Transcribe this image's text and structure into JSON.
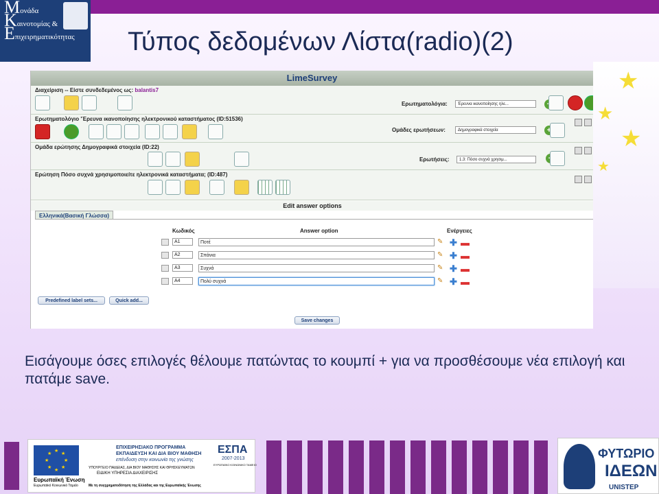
{
  "slide": {
    "title": "Τύπος δεδομένων Λίστα(radio)(2)",
    "description": "Εισάγουμε όσες επιλογές θέλουμε πατώντας το κουμπί + για να προσθέσουμε νέα επιλογή και πατάμε save."
  },
  "logo": {
    "line1_initial": "Μ",
    "line1_rest": "ονάδα",
    "line2_initial": "Κ",
    "line2_rest": "αινοτομίας &",
    "line3_initial": "Ε",
    "line3_rest": "πιχειρηματικότητας"
  },
  "app": {
    "name": "LimeSurvey",
    "admin_label": "Διαχείριση -- Είστε συνδεδεμένος ως:",
    "admin_user": "balantis7",
    "surveys_label": "Ερωτηματολόγια:",
    "surveys_value": "Έρευνα ικανοποίησης ηλε...",
    "survey_bar": "Ερωτηματολόγιο 'Έρευνα ικανοποίησης ηλεκτρονικού καταστήματος (ID:51536)",
    "groups_label": "Ομάδες ερωτήσεων:",
    "groups_value": "Δημογραφικά στοιχεία",
    "group_bar": "Ομάδα ερώτησης Δημογραφικά στοιχεία (ID:22)",
    "questions_label": "Ερωτήσεις:",
    "questions_value": "1.3: Πόσο συχνά χρησιμ...",
    "question_bar_label": "Ερώτηση",
    "question_bar_text": "Πόσο συχνά χρησιμοποιείτε ηλεκτρονικά καταστήματα; (ID:487)",
    "edit_title": "Edit answer options",
    "tab_label": "Ελληνικά(Βασική Γλώσσα)",
    "col_code": "Κωδικός",
    "col_option": "Answer option",
    "col_actions": "Ενέργειες",
    "answers": [
      {
        "code": "A1",
        "text": "Ποτέ"
      },
      {
        "code": "A2",
        "text": "Σπάνια"
      },
      {
        "code": "A3",
        "text": "Συχνά"
      },
      {
        "code": "A4",
        "text": "Πολύ συχνά"
      }
    ],
    "predefined_button": "Predefined label sets...",
    "quick_add_button": "Quick add...",
    "save_button": "Save changes"
  },
  "footer": {
    "eu_label": "Ευρωπαϊκή Ένωση",
    "eu_sub": "Ευρωπαϊκό Κοινωνικό Ταμείο",
    "program_line1": "ΕΠΙΧΕΙΡΗΣΙΑΚΟ ΠΡΟΓΡΑΜΜΑ",
    "program_line2": "ΕΚΠΑΙΔΕΥΣΗ ΚΑΙ ΔΙΑ ΒΙΟΥ ΜΑΘΗΣΗ",
    "program_line3": "επένδυση στην κοινωνία της γνώσης",
    "ministry": "ΥΠΟΥΡΓΕΙΟ ΠΑΙΔΕΙΑΣ, ΔΙΑ ΒΙΟΥ ΜΑΘΗΣΗΣ ΚΑΙ ΘΡΗΣΚΕΥΜΑΤΩΝ",
    "authority": "ΕΙΔΙΚΗ ΥΠΗΡΕΣΙΑ ΔΙΑΧΕΙΡΙΣΗΣ",
    "espa": "ΕΣΠΑ",
    "espa_years": "2007-2013",
    "espa_sub": "ΕΥΡΩΠΑΪΚΟ ΚΟΙΝΩΝΙΚΟ ΤΑΜΕΙΟ",
    "cofund": "Με τη συγχρηματοδότηση της Ελλάδας και της Ευρωπαϊκής Ένωσης",
    "fyt1": "ΦΥΤΩΡΙΟ",
    "fyt2": "ΙΔΕΩΝ",
    "fyt3": "UNISTEP"
  }
}
